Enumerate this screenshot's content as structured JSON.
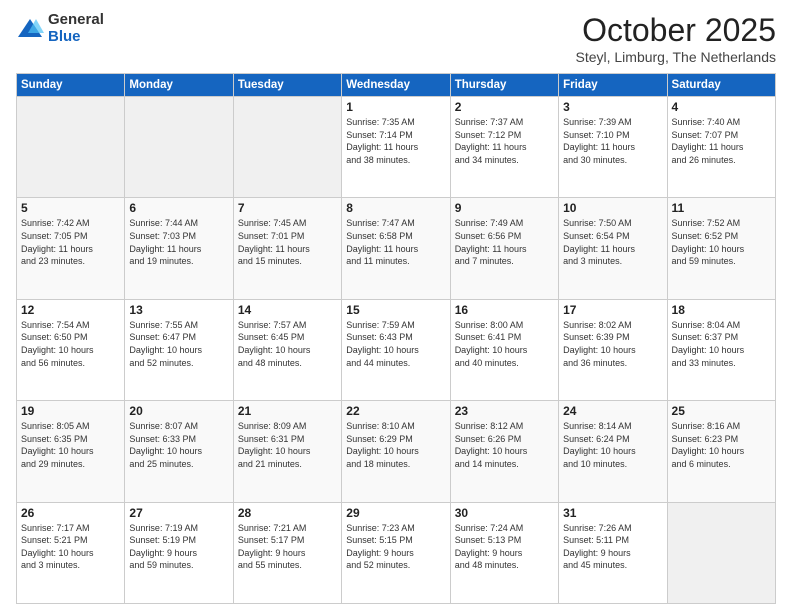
{
  "header": {
    "logo_general": "General",
    "logo_blue": "Blue",
    "month_title": "October 2025",
    "subtitle": "Steyl, Limburg, The Netherlands"
  },
  "days_of_week": [
    "Sunday",
    "Monday",
    "Tuesday",
    "Wednesday",
    "Thursday",
    "Friday",
    "Saturday"
  ],
  "weeks": [
    [
      {
        "day": "",
        "info": ""
      },
      {
        "day": "",
        "info": ""
      },
      {
        "day": "",
        "info": ""
      },
      {
        "day": "1",
        "info": "Sunrise: 7:35 AM\nSunset: 7:14 PM\nDaylight: 11 hours\nand 38 minutes."
      },
      {
        "day": "2",
        "info": "Sunrise: 7:37 AM\nSunset: 7:12 PM\nDaylight: 11 hours\nand 34 minutes."
      },
      {
        "day": "3",
        "info": "Sunrise: 7:39 AM\nSunset: 7:10 PM\nDaylight: 11 hours\nand 30 minutes."
      },
      {
        "day": "4",
        "info": "Sunrise: 7:40 AM\nSunset: 7:07 PM\nDaylight: 11 hours\nand 26 minutes."
      }
    ],
    [
      {
        "day": "5",
        "info": "Sunrise: 7:42 AM\nSunset: 7:05 PM\nDaylight: 11 hours\nand 23 minutes."
      },
      {
        "day": "6",
        "info": "Sunrise: 7:44 AM\nSunset: 7:03 PM\nDaylight: 11 hours\nand 19 minutes."
      },
      {
        "day": "7",
        "info": "Sunrise: 7:45 AM\nSunset: 7:01 PM\nDaylight: 11 hours\nand 15 minutes."
      },
      {
        "day": "8",
        "info": "Sunrise: 7:47 AM\nSunset: 6:58 PM\nDaylight: 11 hours\nand 11 minutes."
      },
      {
        "day": "9",
        "info": "Sunrise: 7:49 AM\nSunset: 6:56 PM\nDaylight: 11 hours\nand 7 minutes."
      },
      {
        "day": "10",
        "info": "Sunrise: 7:50 AM\nSunset: 6:54 PM\nDaylight: 11 hours\nand 3 minutes."
      },
      {
        "day": "11",
        "info": "Sunrise: 7:52 AM\nSunset: 6:52 PM\nDaylight: 10 hours\nand 59 minutes."
      }
    ],
    [
      {
        "day": "12",
        "info": "Sunrise: 7:54 AM\nSunset: 6:50 PM\nDaylight: 10 hours\nand 56 minutes."
      },
      {
        "day": "13",
        "info": "Sunrise: 7:55 AM\nSunset: 6:47 PM\nDaylight: 10 hours\nand 52 minutes."
      },
      {
        "day": "14",
        "info": "Sunrise: 7:57 AM\nSunset: 6:45 PM\nDaylight: 10 hours\nand 48 minutes."
      },
      {
        "day": "15",
        "info": "Sunrise: 7:59 AM\nSunset: 6:43 PM\nDaylight: 10 hours\nand 44 minutes."
      },
      {
        "day": "16",
        "info": "Sunrise: 8:00 AM\nSunset: 6:41 PM\nDaylight: 10 hours\nand 40 minutes."
      },
      {
        "day": "17",
        "info": "Sunrise: 8:02 AM\nSunset: 6:39 PM\nDaylight: 10 hours\nand 36 minutes."
      },
      {
        "day": "18",
        "info": "Sunrise: 8:04 AM\nSunset: 6:37 PM\nDaylight: 10 hours\nand 33 minutes."
      }
    ],
    [
      {
        "day": "19",
        "info": "Sunrise: 8:05 AM\nSunset: 6:35 PM\nDaylight: 10 hours\nand 29 minutes."
      },
      {
        "day": "20",
        "info": "Sunrise: 8:07 AM\nSunset: 6:33 PM\nDaylight: 10 hours\nand 25 minutes."
      },
      {
        "day": "21",
        "info": "Sunrise: 8:09 AM\nSunset: 6:31 PM\nDaylight: 10 hours\nand 21 minutes."
      },
      {
        "day": "22",
        "info": "Sunrise: 8:10 AM\nSunset: 6:29 PM\nDaylight: 10 hours\nand 18 minutes."
      },
      {
        "day": "23",
        "info": "Sunrise: 8:12 AM\nSunset: 6:26 PM\nDaylight: 10 hours\nand 14 minutes."
      },
      {
        "day": "24",
        "info": "Sunrise: 8:14 AM\nSunset: 6:24 PM\nDaylight: 10 hours\nand 10 minutes."
      },
      {
        "day": "25",
        "info": "Sunrise: 8:16 AM\nSunset: 6:23 PM\nDaylight: 10 hours\nand 6 minutes."
      }
    ],
    [
      {
        "day": "26",
        "info": "Sunrise: 7:17 AM\nSunset: 5:21 PM\nDaylight: 10 hours\nand 3 minutes."
      },
      {
        "day": "27",
        "info": "Sunrise: 7:19 AM\nSunset: 5:19 PM\nDaylight: 9 hours\nand 59 minutes."
      },
      {
        "day": "28",
        "info": "Sunrise: 7:21 AM\nSunset: 5:17 PM\nDaylight: 9 hours\nand 55 minutes."
      },
      {
        "day": "29",
        "info": "Sunrise: 7:23 AM\nSunset: 5:15 PM\nDaylight: 9 hours\nand 52 minutes."
      },
      {
        "day": "30",
        "info": "Sunrise: 7:24 AM\nSunset: 5:13 PM\nDaylight: 9 hours\nand 48 minutes."
      },
      {
        "day": "31",
        "info": "Sunrise: 7:26 AM\nSunset: 5:11 PM\nDaylight: 9 hours\nand 45 minutes."
      },
      {
        "day": "",
        "info": ""
      }
    ]
  ]
}
